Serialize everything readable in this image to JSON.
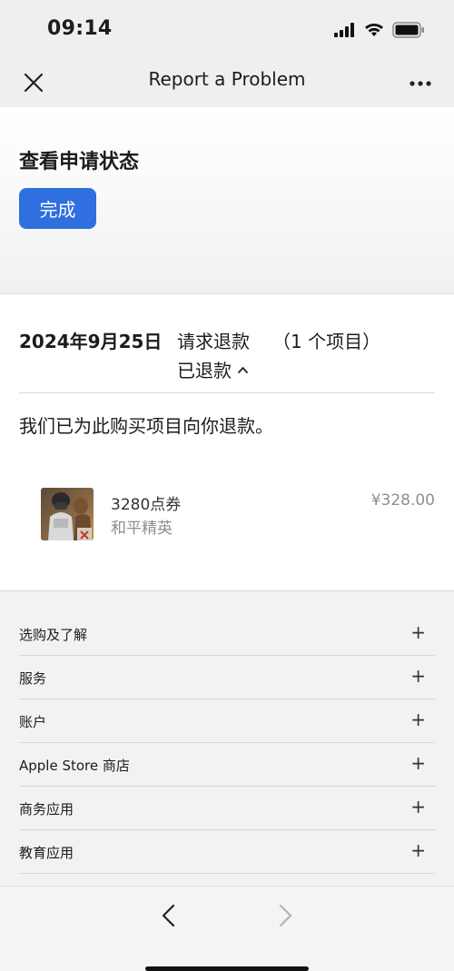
{
  "status_bar": {
    "time": "09:14"
  },
  "header": {
    "title": "Report a Problem"
  },
  "status_section": {
    "title": "查看申请状态",
    "done_label": "完成"
  },
  "request": {
    "date": "2024年9月25日",
    "type": "请求退款",
    "count": "（1 个项目）",
    "status": "已退款",
    "message": "我们已为此购买项目向你退款。",
    "item": {
      "name": "3280点券",
      "app": "和平精英",
      "price": "¥328.00"
    }
  },
  "footer_links": [
    {
      "label": "选购及了解"
    },
    {
      "label": "服务"
    },
    {
      "label": "账户"
    },
    {
      "label": "Apple Store 商店"
    },
    {
      "label": "商务应用"
    },
    {
      "label": "教育应用"
    }
  ],
  "colors": {
    "accent": "#2f6fe0",
    "secondary_text": "#8e8e93"
  }
}
